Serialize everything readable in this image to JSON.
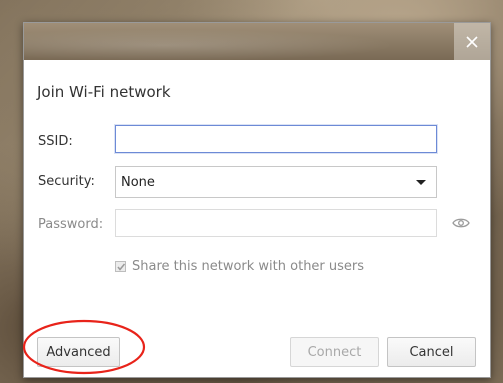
{
  "dialog": {
    "title": "Join Wi-Fi network",
    "close_icon": "close-icon",
    "fields": {
      "ssid": {
        "label": "SSID:",
        "value": "",
        "placeholder": ""
      },
      "security": {
        "label": "Security:",
        "selected": "None"
      },
      "password": {
        "label": "Password:",
        "value": "",
        "placeholder": "",
        "toggle_icon": "eye-icon"
      }
    },
    "share": {
      "label": "Share this network with other users",
      "checked": true
    },
    "buttons": {
      "advanced": "Advanced",
      "connect": "Connect",
      "cancel": "Cancel"
    },
    "annotation_color": "#e8231a"
  }
}
